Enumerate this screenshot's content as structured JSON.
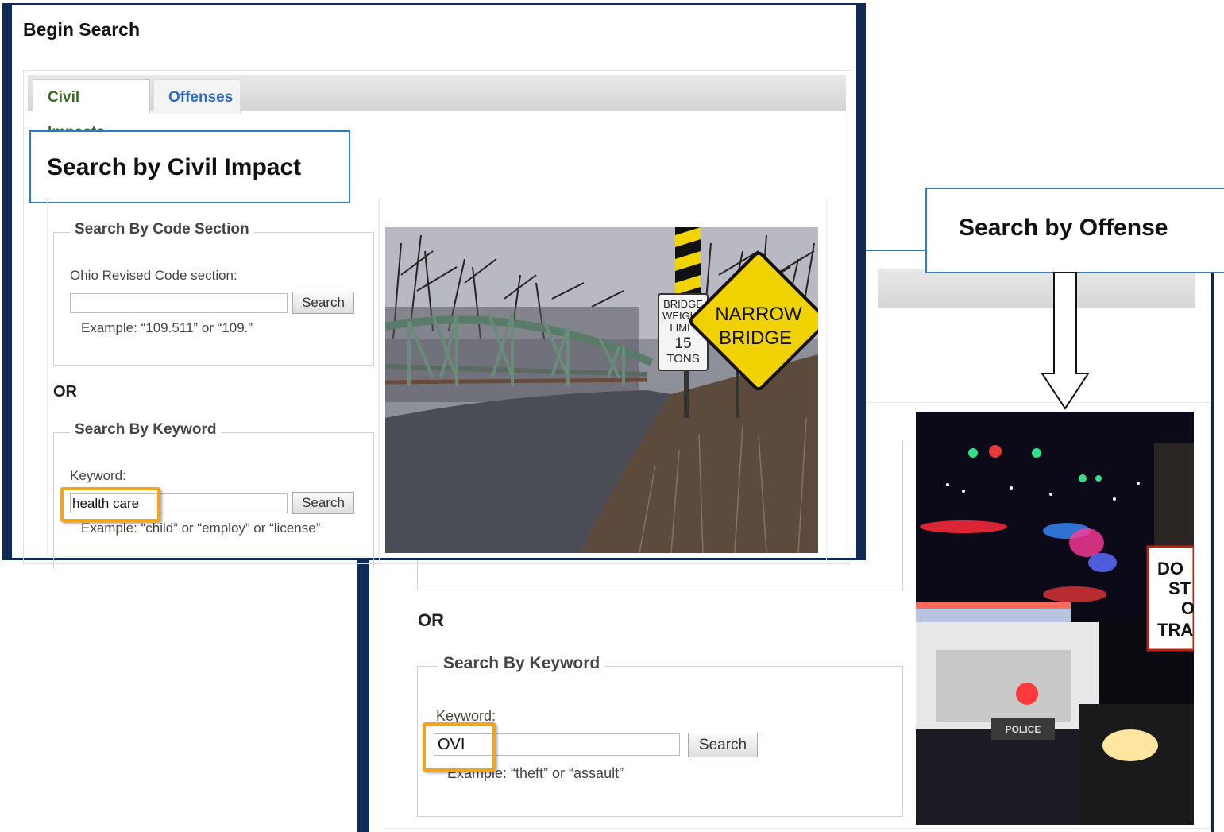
{
  "civil_panel": {
    "title": "Begin Search",
    "tabs": [
      {
        "label": "Civil Impacts",
        "active": true
      },
      {
        "label": "Offenses",
        "active": false
      }
    ],
    "callout": "Search by Civil Impact",
    "code_section": {
      "legend": "Search By Code Section",
      "label": "Ohio Revised Code section:",
      "value": "",
      "button": "Search",
      "example": "Example: “109.511” or “109.”"
    },
    "or_label": "OR",
    "keyword": {
      "legend": "Search By Keyword",
      "label": "Keyword:",
      "value": "health care",
      "button": "Search",
      "example": "Example: “child” or “employ” or “license”"
    },
    "photo": {
      "signs": {
        "weight": [
          "BRIDGE",
          "WEIGHT",
          "LIMIT",
          "15",
          "TONS"
        ],
        "warning": [
          "NARROW",
          "BRIDGE"
        ]
      }
    }
  },
  "offense_panel": {
    "callout": "Search by Offense",
    "or_label": "OR",
    "keyword": {
      "legend": "Search By Keyword",
      "label": "Keyword:",
      "value": "OVI",
      "button": "Search",
      "example": "Example: “theft” or “assault”"
    },
    "photo": {
      "car_label": "POLICE",
      "sign": [
        "DO",
        "ST",
        "O",
        "TRA"
      ]
    }
  },
  "colors": {
    "frame": "#0f2a57",
    "callout_border": "#2d7cc4",
    "highlight": "#f0a41f",
    "active_tab": "#3a6e1e",
    "inactive_tab": "#2a6cbf"
  }
}
